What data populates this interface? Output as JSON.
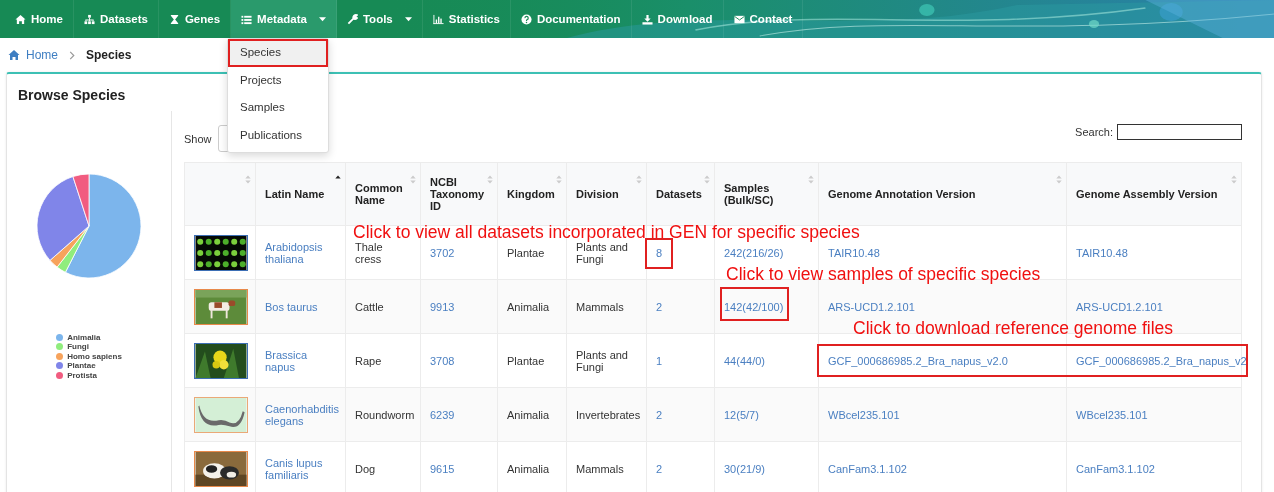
{
  "nav": {
    "items": [
      {
        "label": "Home",
        "selected": false,
        "has_menu": false
      },
      {
        "label": "Datasets",
        "selected": false,
        "has_menu": false
      },
      {
        "label": "Genes",
        "selected": false,
        "has_menu": false
      },
      {
        "label": "Metadata",
        "selected": true,
        "has_menu": true
      },
      {
        "label": "Tools",
        "selected": false,
        "has_menu": true
      },
      {
        "label": "Statistics",
        "selected": false,
        "has_menu": false
      },
      {
        "label": "Documentation",
        "selected": false,
        "has_menu": false
      },
      {
        "label": "Download",
        "selected": false,
        "has_menu": false
      },
      {
        "label": "Contact",
        "selected": false,
        "has_menu": false
      }
    ]
  },
  "dropdown": {
    "items": [
      {
        "label": "Species",
        "selected": true
      },
      {
        "label": "Projects",
        "selected": false
      },
      {
        "label": "Samples",
        "selected": false
      },
      {
        "label": "Publications",
        "selected": false
      }
    ]
  },
  "breadcrumb": [
    {
      "label": "Home",
      "kind": "link"
    },
    {
      "label": "Species",
      "kind": "current"
    }
  ],
  "card": {
    "title": "Browse Species"
  },
  "legend": [
    {
      "label": "Animalia",
      "color": "#7cb5ec"
    },
    {
      "label": "Fungi",
      "color": "#90ed7d"
    },
    {
      "label": "Homo sapiens",
      "color": "#f7a35c"
    },
    {
      "label": "Plantae",
      "color": "#8085e9"
    },
    {
      "label": "Protista",
      "color": "#f15c80"
    }
  ],
  "table": {
    "show_label": "Show",
    "search_label": "Search:",
    "columns": [
      {
        "kind": "picture",
        "sorted": false
      },
      {
        "label": "Latin Name",
        "kind": "link",
        "sorted": true
      },
      {
        "label": "Common Name",
        "kind": "text",
        "sorted": false
      },
      {
        "label": "NCBI Taxonomy ID",
        "kind": "link",
        "sorted": false
      },
      {
        "label": "Kingdom",
        "kind": "text",
        "sorted": false
      },
      {
        "label": "Division",
        "kind": "text",
        "sorted": false
      },
      {
        "label": "Datasets",
        "kind": "link",
        "sorted": false
      },
      {
        "label": "Samples (Bulk/SC)",
        "kind": "link",
        "sorted": false
      },
      {
        "label": "Genome Annotation Version",
        "kind": "link",
        "sorted": false
      },
      {
        "label": "Genome Assembly Version",
        "kind": "link",
        "sorted": false
      }
    ],
    "rows": [
      {
        "datasets_highlighted": true,
        "samples_highlighted": false,
        "genome_highlighted": false,
        "cells": [
          "",
          "Arabidopsis thaliana",
          "Thale cress",
          "3702",
          "Plantae",
          "Plants and Fungi",
          "8",
          "242(216/26)",
          "TAIR10.48",
          "TAIR10.48"
        ]
      },
      {
        "datasets_highlighted": false,
        "samples_highlighted": true,
        "genome_highlighted": false,
        "cells": [
          "",
          "Bos taurus",
          "Cattle",
          "9913",
          "Animalia",
          "Mammals",
          "2",
          "142(42/100)",
          "ARS-UCD1.2.101",
          "ARS-UCD1.2.101"
        ]
      },
      {
        "datasets_highlighted": false,
        "samples_highlighted": false,
        "genome_highlighted": true,
        "cells": [
          "",
          "Brassica napus",
          "Rape",
          "3708",
          "Plantae",
          "Plants and Fungi",
          "1",
          "44(44/0)",
          "GCF_000686985.2_Bra_napus_v2.0",
          "GCF_000686985.2_Bra_napus_v2"
        ]
      },
      {
        "datasets_highlighted": false,
        "samples_highlighted": false,
        "genome_highlighted": false,
        "cells": [
          "",
          "Caenorhabditis elegans",
          "Roundworm",
          "6239",
          "Animalia",
          "Invertebrates",
          "2",
          "12(5/7)",
          "WBcel235.101",
          "WBcel235.101"
        ]
      },
      {
        "datasets_highlighted": false,
        "samples_highlighted": false,
        "genome_highlighted": false,
        "cells": [
          "",
          "Canis lupus familiaris",
          "Dog",
          "9615",
          "Animalia",
          "Mammals",
          "2",
          "30(21/9)",
          "CanFam3.1.102",
          "CanFam3.1.102"
        ]
      }
    ]
  },
  "annotations": [
    {
      "text": "Click to view all datasets incorporated in GEN for specific species"
    },
    {
      "text": "Click to view samples of specific species"
    },
    {
      "text": "Click to download reference genome files"
    }
  ]
}
